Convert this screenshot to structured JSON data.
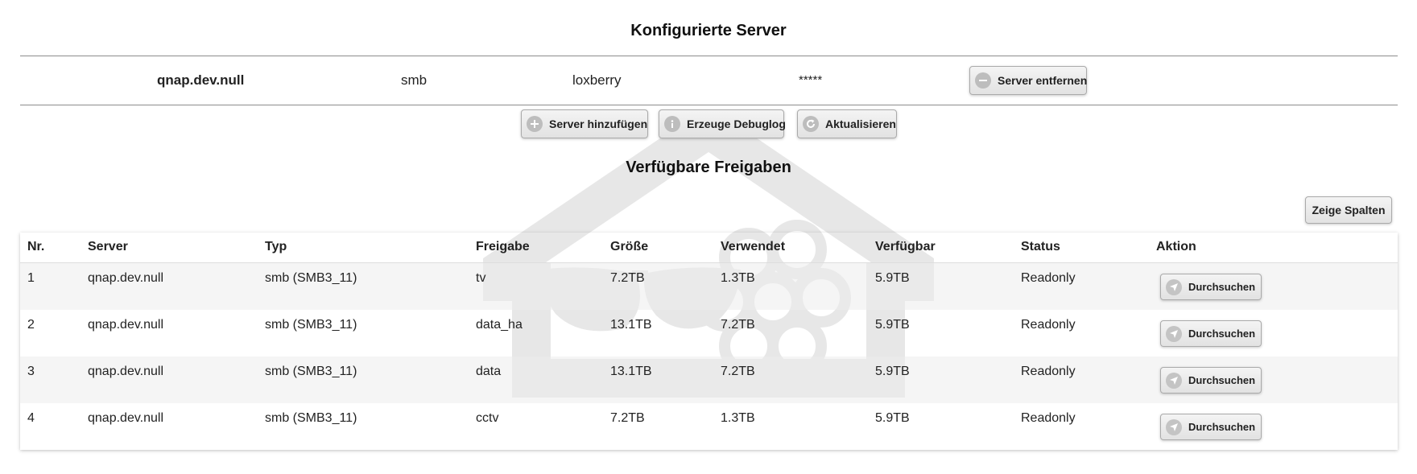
{
  "configured": {
    "title": "Konfigurierte Server",
    "server": {
      "host": "qnap.dev.null",
      "type": "smb",
      "user": "loxberry",
      "password": "*****"
    },
    "remove_button": "Server entfernen"
  },
  "toolbar": {
    "add_label": "Server hinzufügen",
    "debug_label": "Erzeuge Debuglog",
    "refresh_label": "Aktualisieren"
  },
  "shares": {
    "title": "Verfügbare Freigaben",
    "columns_button": "Zeige Spalten",
    "headers": [
      "Nr.",
      "Server",
      "Typ",
      "Freigabe",
      "Größe",
      "Verwendet",
      "Verfügbar",
      "Status",
      "Aktion"
    ],
    "rows": [
      {
        "nr": "1",
        "server": "qnap.dev.null",
        "typ": "smb (SMB3_11)",
        "share": "tv",
        "size": "7.2TB",
        "used": "1.3TB",
        "avail": "5.9TB",
        "status": "Readonly",
        "action": "Durchsuchen"
      },
      {
        "nr": "2",
        "server": "qnap.dev.null",
        "typ": "smb (SMB3_11)",
        "share": "data_ha",
        "size": "13.1TB",
        "used": "7.2TB",
        "avail": "5.9TB",
        "status": "Readonly",
        "action": "Durchsuchen"
      },
      {
        "nr": "3",
        "server": "qnap.dev.null",
        "typ": "smb (SMB3_11)",
        "share": "data",
        "size": "13.1TB",
        "used": "7.2TB",
        "avail": "5.9TB",
        "status": "Readonly",
        "action": "Durchsuchen"
      },
      {
        "nr": "4",
        "server": "qnap.dev.null",
        "typ": "smb (SMB3_11)",
        "share": "cctv",
        "size": "7.2TB",
        "used": "1.3TB",
        "avail": "5.9TB",
        "status": "Readonly",
        "action": "Durchsuchen"
      }
    ]
  },
  "icons": {
    "remove": "minus-circle-icon",
    "add": "plus-circle-icon",
    "debug": "info-icon",
    "refresh": "refresh-icon",
    "browse": "navigation-arrow-icon"
  }
}
